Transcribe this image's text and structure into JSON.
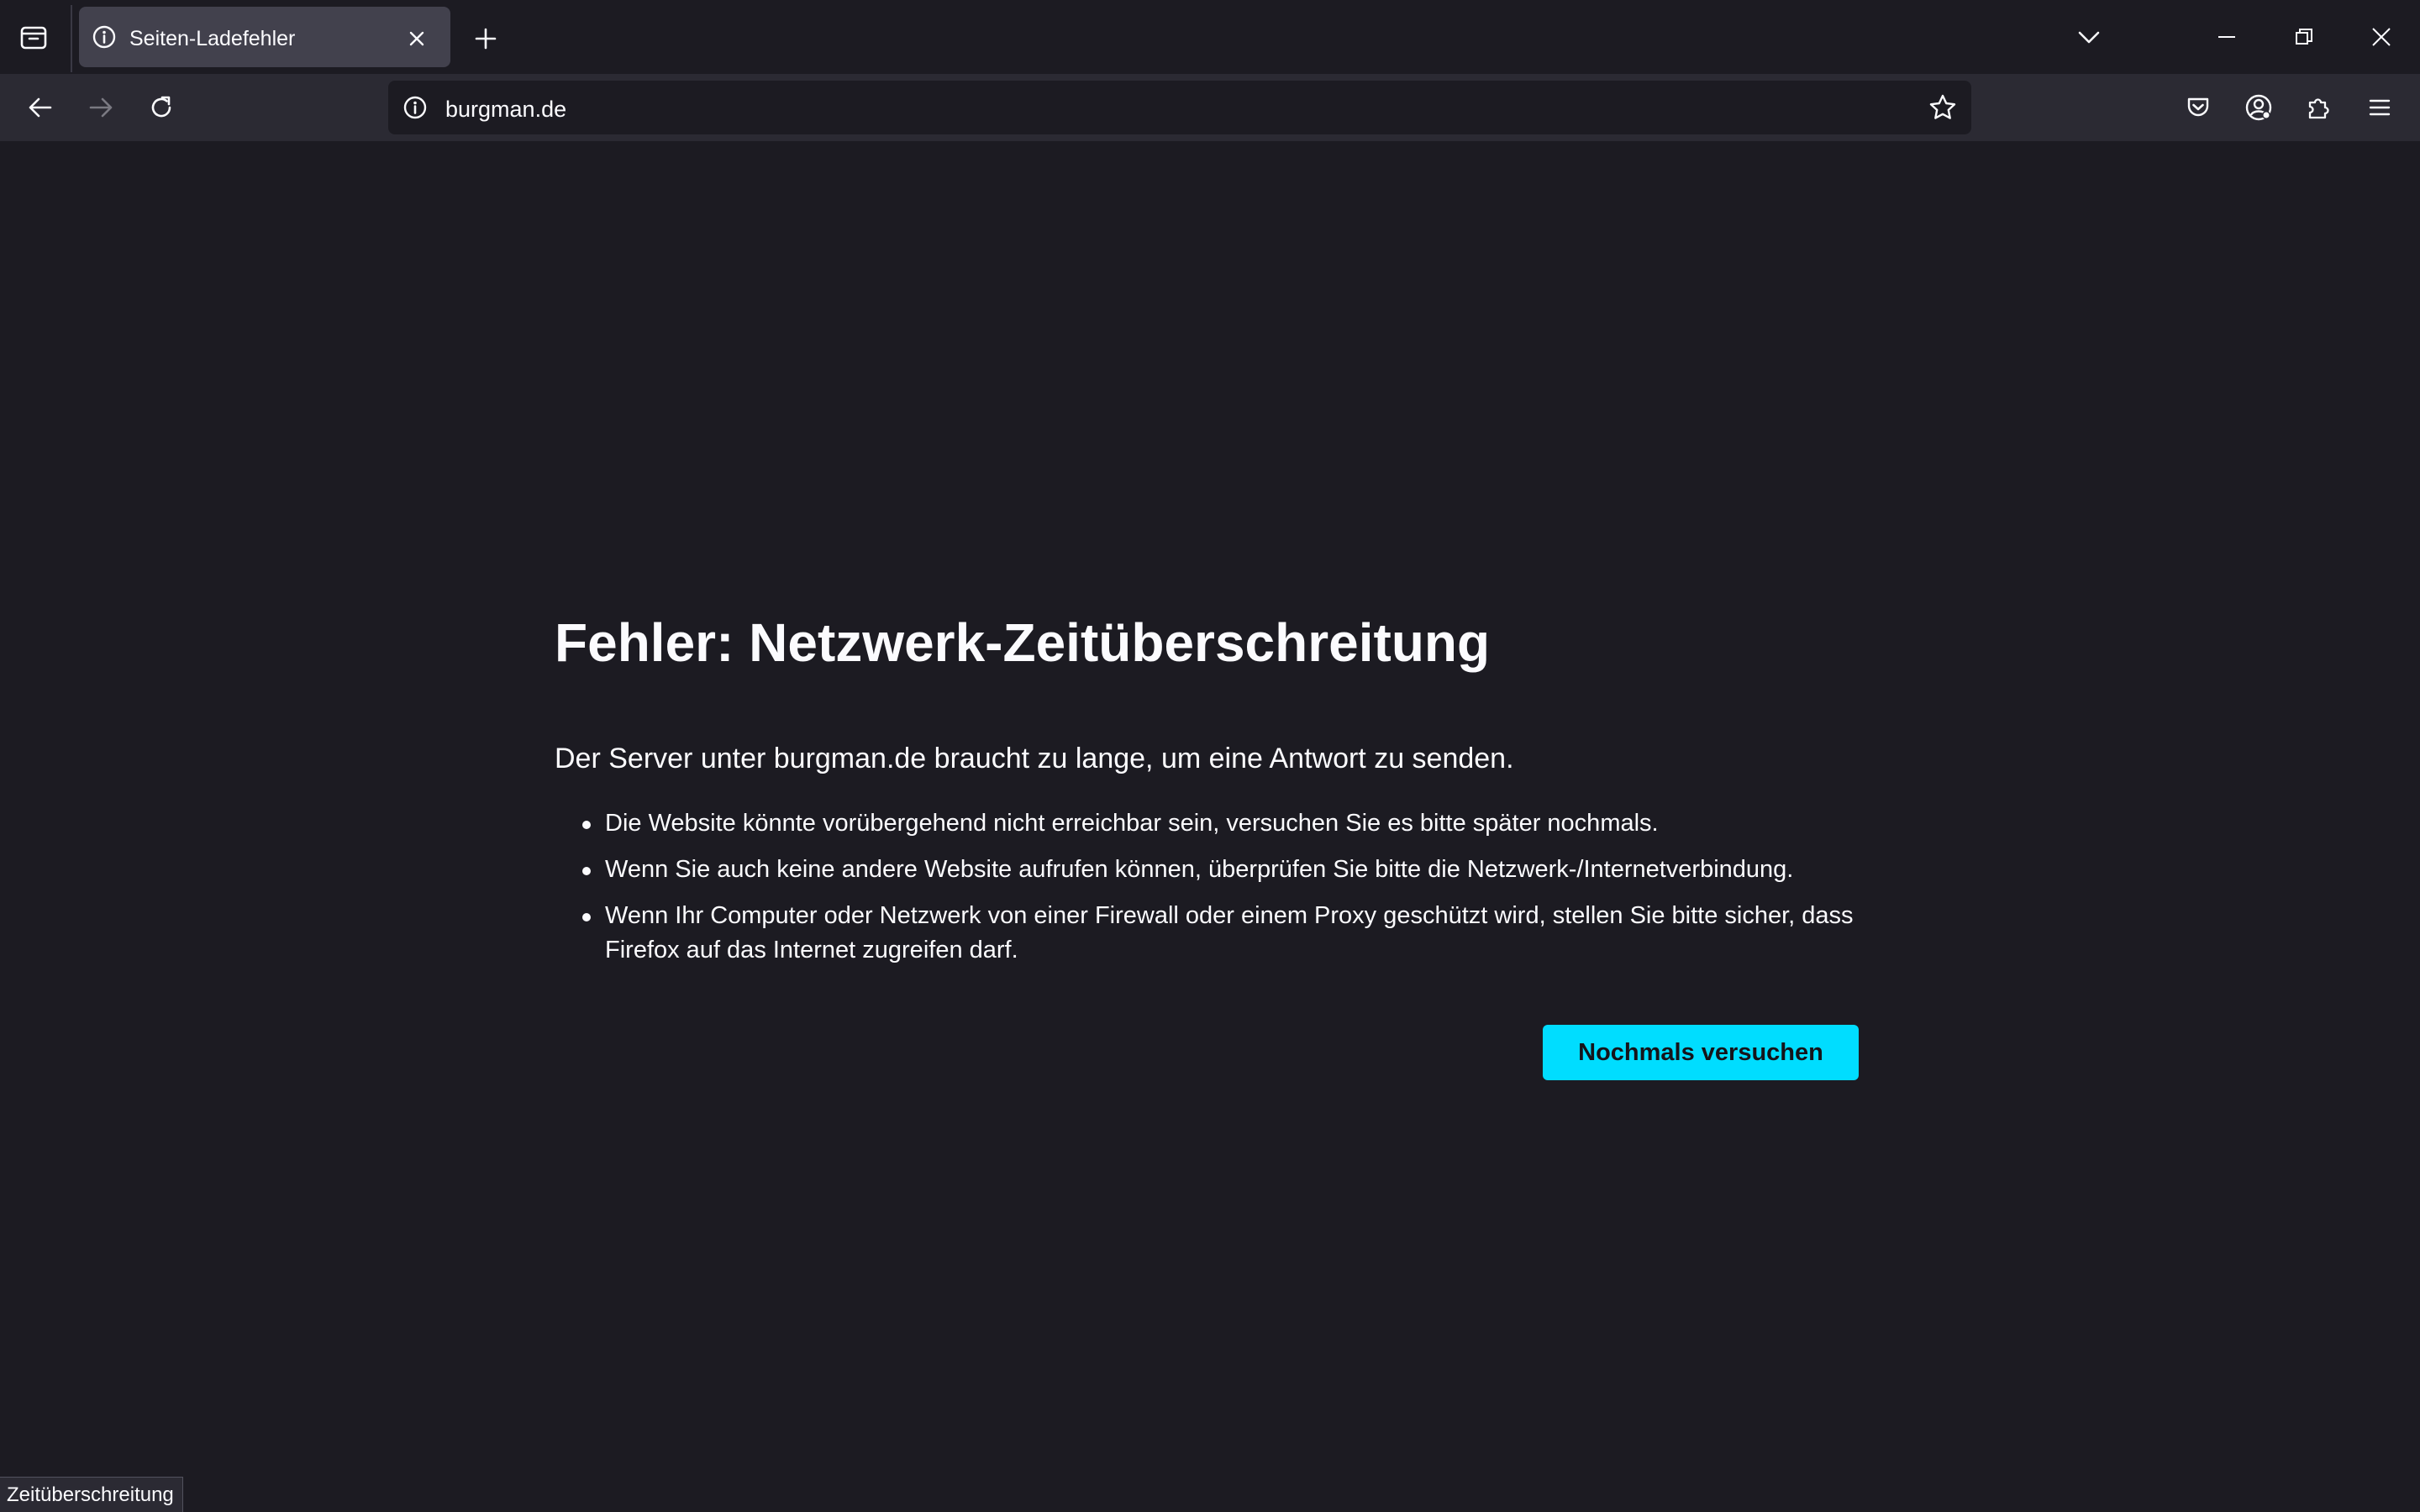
{
  "browser": {
    "tab": {
      "title": "Seiten-Ladefehler",
      "favicon": "info-icon"
    },
    "url": "burgman.de",
    "colors": {
      "accent": "#00ddff",
      "page_background": "#1c1b22",
      "toolbar_background": "#2b2a33",
      "active_tab": "#42414d"
    }
  },
  "error_page": {
    "title": "Fehler: Netzwerk-Zeitüberschreitung",
    "description": "Der Server unter burgman.de braucht zu lange, um eine Antwort zu senden.",
    "suggestions": [
      "Die Website könnte vorübergehend nicht erreichbar sein, versuchen Sie es bitte später nochmals.",
      "Wenn Sie auch keine andere Website aufrufen können, überprüfen Sie bitte die Netzwerk-/Internetverbindung.",
      "Wenn Ihr Computer oder Netzwerk von einer Firewall oder einem Proxy geschützt wird, stellen Sie bitte sicher, dass Firefox auf das Internet zugreifen darf."
    ],
    "retry_button": "Nochmals versuchen"
  },
  "status_bar": {
    "text": "Zeitüberschreitung"
  }
}
